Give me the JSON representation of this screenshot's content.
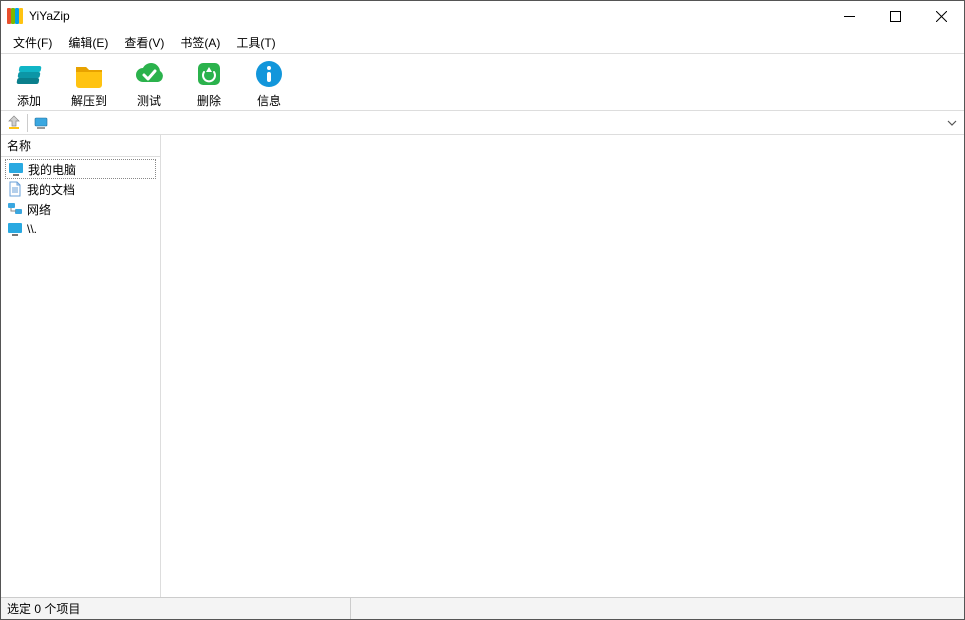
{
  "title": "YiYaZip",
  "menu": {
    "file": "文件(F)",
    "edit": "编辑(E)",
    "view": "查看(V)",
    "bookmark": "书签(A)",
    "tools": "工具(T)"
  },
  "toolbar": {
    "add": "添加",
    "extract": "解压到",
    "test": "测试",
    "delete": "删除",
    "info": "信息"
  },
  "addressbar": {
    "value": ""
  },
  "list": {
    "header_name": "名称",
    "items": [
      {
        "label": "我的电脑",
        "icon": "monitor"
      },
      {
        "label": "我的文档",
        "icon": "document"
      },
      {
        "label": "网络",
        "icon": "network"
      },
      {
        "label": "\\\\.",
        "icon": "screen"
      }
    ]
  },
  "status": {
    "selected": "选定 0 个项目"
  }
}
